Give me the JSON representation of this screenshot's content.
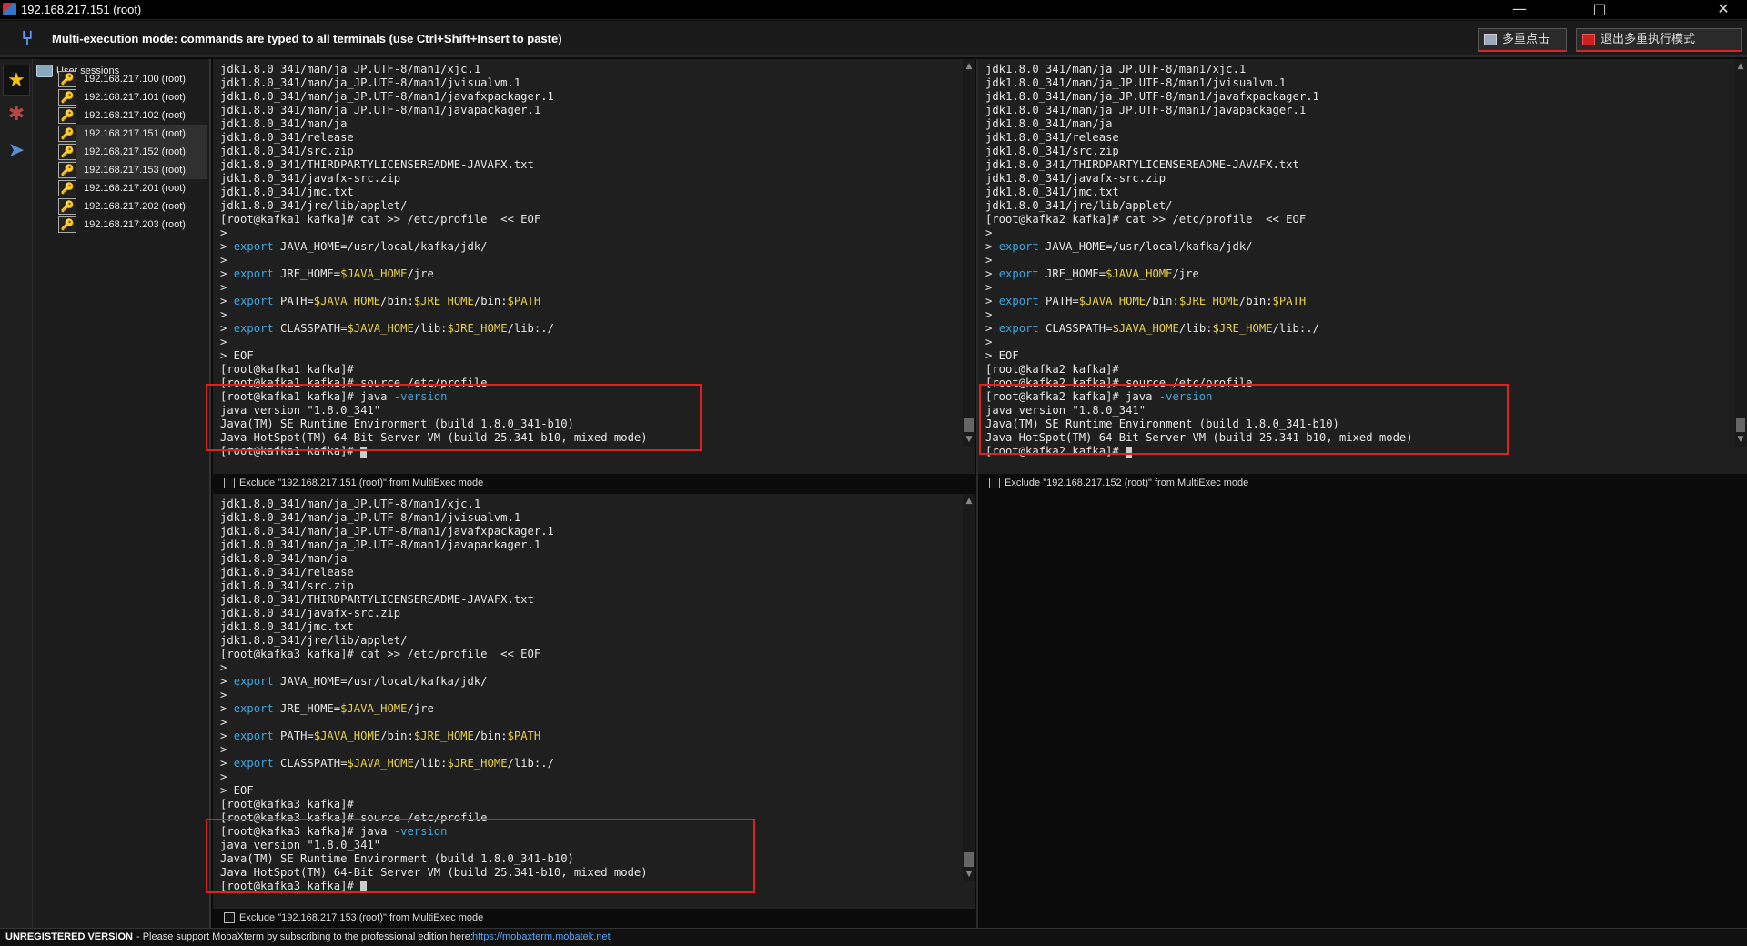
{
  "window": {
    "title": "192.168.217.151 (root)",
    "min": "—",
    "max": "□",
    "close": "✕"
  },
  "multiexec": {
    "message": "Multi-execution mode: commands are typed to all terminals (use Ctrl+Shift+Insert to paste)",
    "button1": "多重点击",
    "button2": "退出多重执行模式"
  },
  "sidebar": {
    "root_label": "User sessions",
    "items": [
      {
        "label": "192.168.217.100 (root)"
      },
      {
        "label": "192.168.217.101 (root)"
      },
      {
        "label": "192.168.217.102 (root)"
      },
      {
        "label": "192.168.217.151 (root)"
      },
      {
        "label": "192.168.217.152 (root)"
      },
      {
        "label": "192.168.217.153 (root)"
      },
      {
        "label": "192.168.217.201 (root)"
      },
      {
        "label": "192.168.217.202 (root)"
      },
      {
        "label": "192.168.217.203 (root)"
      }
    ]
  },
  "terminals": [
    {
      "host": "kafka1",
      "exclude_label": "Exclude \"192.168.217.151 (root)\" from MultiExec mode"
    },
    {
      "host": "kafka2",
      "exclude_label": "Exclude \"192.168.217.152 (root)\" from MultiExec mode"
    },
    {
      "host": "kafka3",
      "exclude_label": "Exclude \"192.168.217.153 (root)\" from MultiExec mode"
    }
  ],
  "terminal_common": {
    "listing": [
      "jdk1.8.0_341/man/ja_JP.UTF-8/man1/xjc.1",
      "jdk1.8.0_341/man/ja_JP.UTF-8/man1/jvisualvm.1",
      "jdk1.8.0_341/man/ja_JP.UTF-8/man1/javafxpackager.1",
      "jdk1.8.0_341/man/ja_JP.UTF-8/man1/javapackager.1",
      "jdk1.8.0_341/man/ja",
      "jdk1.8.0_341/release",
      "jdk1.8.0_341/src.zip",
      "jdk1.8.0_341/THIRDPARTYLICENSEREADME-JAVAFX.txt",
      "jdk1.8.0_341/javafx-src.zip",
      "jdk1.8.0_341/jmc.txt",
      "jdk1.8.0_341/jre/lib/applet/"
    ],
    "cat_cmd": " kafka]# cat >> /etc/profile  << EOF",
    "export_kw": "export",
    "java_home": " JAVA_HOME=/usr/local/kafka/jdk/",
    "jre_prefix": " JRE_HOME=",
    "jre_var": "$JAVA_HOME",
    "jre_suffix": "/jre",
    "path_prefix": " PATH=",
    "path_v1": "$JAVA_HOME",
    "path_m1": "/bin:",
    "path_v2": "$JRE_HOME",
    "path_m2": "/bin:",
    "path_v3": "$PATH",
    "cp_prefix": " CLASSPATH=",
    "cp_v1": "$JAVA_HOME",
    "cp_m1": "/lib:",
    "cp_v2": "$JRE_HOME",
    "cp_m2": "/lib:./",
    "eof": "> EOF",
    "gt": ">",
    "prompt_end": " kafka]#",
    "source_cmd": " kafka]# source /etc/profile",
    "java_cmd": " kafka]# java ",
    "java_flag": "-version",
    "ver1": "java version \"1.8.0_341\"",
    "ver2": "Java(TM) SE Runtime Environment (build 1.8.0_341-b10)",
    "ver3": "Java HotSpot(TM) 64-Bit Server VM (build 25.341-b10, mixed mode)",
    "last_prompt": " kafka]# "
  },
  "status": {
    "unregistered": "UNREGISTERED VERSION",
    "support": "-  Please support MobaXterm by subscribing to the professional edition here:",
    "link": "https://mobaxterm.mobatek.net"
  }
}
